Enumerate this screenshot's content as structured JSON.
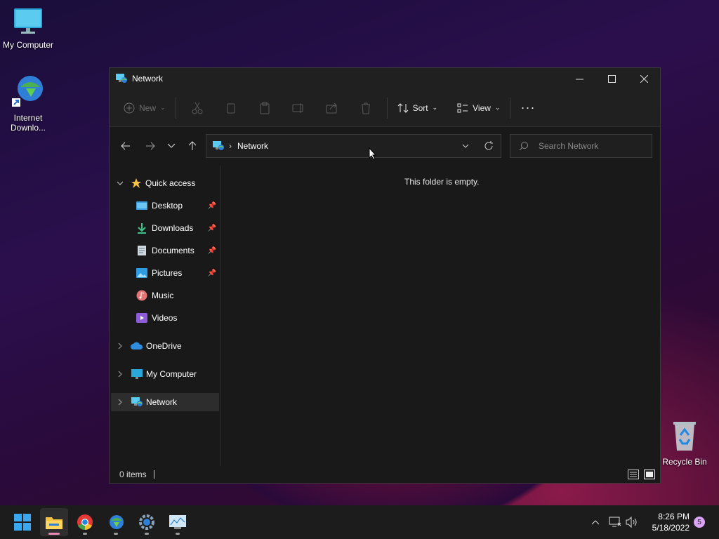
{
  "desktop": {
    "icons": [
      {
        "label": "My Computer",
        "icon": "monitor-icon"
      },
      {
        "label": "Internet Downlo...",
        "icon": "idm-icon"
      },
      {
        "label": "Recycle Bin",
        "icon": "recycle-bin-icon"
      }
    ]
  },
  "window": {
    "title": "Network",
    "toolbar": {
      "new_label": "New",
      "sort_label": "Sort",
      "view_label": "View"
    },
    "address": {
      "path": "Network"
    },
    "search": {
      "placeholder": "Search Network"
    },
    "sidebar": {
      "quick_access": "Quick access",
      "items": [
        {
          "label": "Desktop",
          "pinned": true
        },
        {
          "label": "Downloads",
          "pinned": true
        },
        {
          "label": "Documents",
          "pinned": true
        },
        {
          "label": "Pictures",
          "pinned": true
        },
        {
          "label": "Music",
          "pinned": false
        },
        {
          "label": "Videos",
          "pinned": false
        }
      ],
      "onedrive": "OneDrive",
      "my_computer": "My Computer",
      "network": "Network"
    },
    "content": {
      "empty_message": "This folder is empty."
    },
    "status": {
      "items": "0 items"
    }
  },
  "taskbar": {
    "time": "8:26 PM",
    "date": "5/18/2022",
    "notification_count": "5"
  },
  "colors": {
    "accent": "#0078d4",
    "folder": "#f5c342",
    "badge": "#d9a3f5"
  }
}
